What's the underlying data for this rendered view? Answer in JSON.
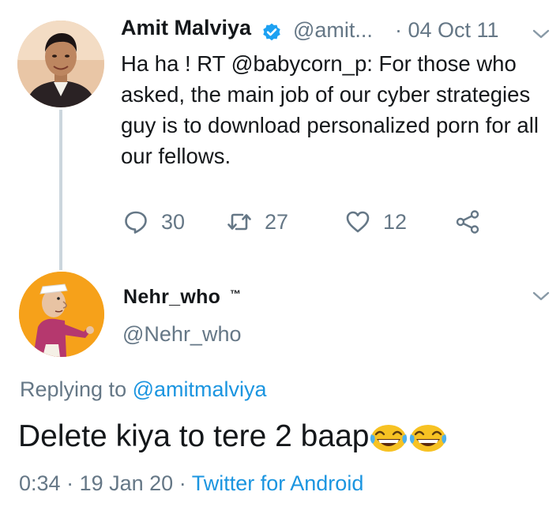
{
  "tweet": {
    "author_name": "Amit Malviya",
    "handle": "@amit...",
    "time": "· 04 Oct 11",
    "text": "Ha ha ! RT @babycorn_p: For those who asked, the main job of our cyber strategies guy is to download personalized porn for all our fellows.",
    "stats": {
      "replies": "30",
      "retweets": "27",
      "likes": "12"
    }
  },
  "reply": {
    "author_name": "Nehr_who",
    "trademark": "™",
    "handle": "@Nehr_who",
    "replying_label": "Replying to",
    "replying_to": "@amitmalviya",
    "text": "Delete kiya to tere 2 baap",
    "emojis": [
      "face-with-tears-of-joy-icon",
      "face-with-tears-of-joy-icon"
    ],
    "time": "0:34",
    "date": "19 Jan 20",
    "separator": "·",
    "client": "Twitter for Android"
  },
  "colors": {
    "text": "#14171a",
    "secondary": "#657786",
    "link": "#1b95e0",
    "verified": "#1da1f2",
    "thread_line": "#ccd6dd"
  }
}
